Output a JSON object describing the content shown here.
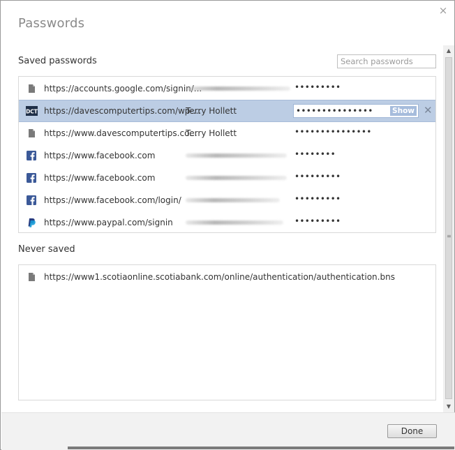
{
  "dialog": {
    "title": "Passwords",
    "close_glyph": "×"
  },
  "saved": {
    "label": "Saved passwords",
    "search_placeholder": "Search passwords",
    "rows": [
      {
        "icon": "page-icon",
        "url": "https://accounts.google.com/signin/...",
        "user": "",
        "password": "•••••••••"
      },
      {
        "icon": "dct-favicon",
        "url": "https://davescomputertips.com/wp-...",
        "user": "Terry Hollett",
        "password": "•••••••••••••••",
        "show_label": "Show",
        "remove_glyph": "✕"
      },
      {
        "icon": "page-icon",
        "url": "https://www.davescomputertips.co...",
        "user": "Terry Hollett",
        "password": "•••••••••••••••"
      },
      {
        "icon": "facebook-icon",
        "url": "https://www.facebook.com",
        "user": "",
        "password": "••••••••"
      },
      {
        "icon": "facebook-icon",
        "url": "https://www.facebook.com",
        "user": "",
        "password": "•••••••••"
      },
      {
        "icon": "facebook-icon",
        "url": "https://www.facebook.com/login/",
        "user": "",
        "password": "•••••••••"
      },
      {
        "icon": "paypal-icon",
        "url": "https://www.paypal.com/signin",
        "user": "",
        "password": "•••••••••"
      }
    ]
  },
  "never": {
    "label": "Never saved",
    "rows": [
      {
        "icon": "page-icon",
        "url": "https://www1.scotiaonline.scotiabank.com/online/authentication/authentication.bns"
      }
    ]
  },
  "footer": {
    "done_label": "Done"
  },
  "colors": {
    "selected_row": "#bccde4",
    "facebook": "#3b5998",
    "paypal_dark": "#253b80",
    "paypal_light": "#179bd7"
  }
}
